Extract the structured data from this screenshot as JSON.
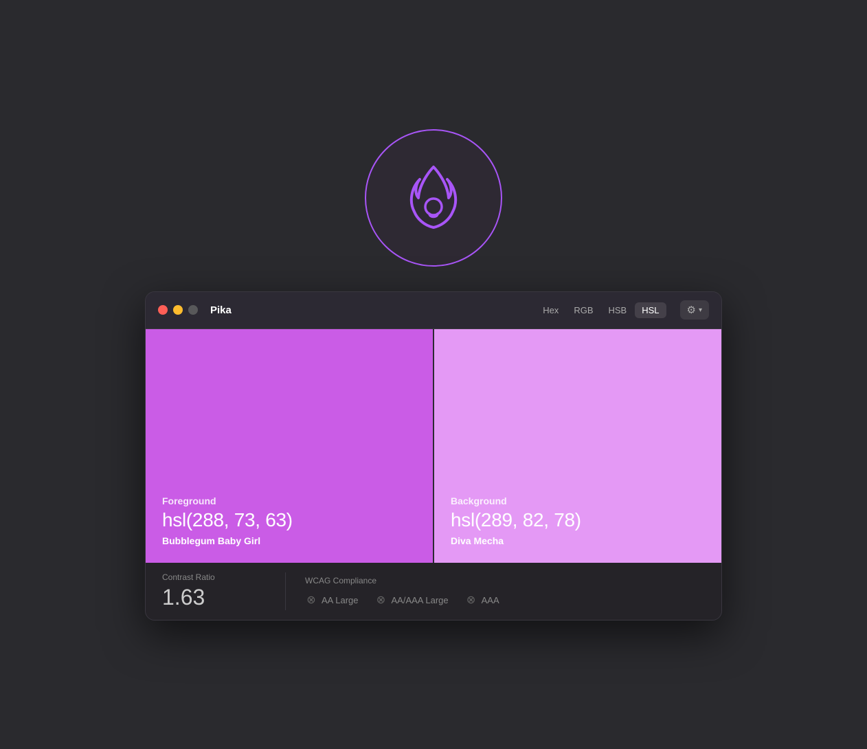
{
  "app": {
    "title": "Pika"
  },
  "header": {
    "format_buttons": [
      {
        "label": "Hex",
        "active": false
      },
      {
        "label": "RGB",
        "active": false
      },
      {
        "label": "HSB",
        "active": false
      },
      {
        "label": "HSL",
        "active": true
      }
    ],
    "settings_label": "⚙",
    "chevron_label": "▾"
  },
  "foreground": {
    "label": "Foreground",
    "value": "hsl(288, 73, 63)",
    "name": "Bubblegum Baby Girl"
  },
  "background": {
    "label": "Background",
    "value": "hsl(289, 82, 78)",
    "name": "Diva Mecha"
  },
  "contrast": {
    "label": "Contrast Ratio",
    "value": "1.63"
  },
  "wcag": {
    "label": "WCAG Compliance",
    "items": [
      {
        "label": "AA Large"
      },
      {
        "label": "AA/AAA Large"
      },
      {
        "label": "AAA"
      }
    ]
  },
  "traffic_lights": {
    "close": "close",
    "minimize": "minimize",
    "maximize": "maximize"
  }
}
